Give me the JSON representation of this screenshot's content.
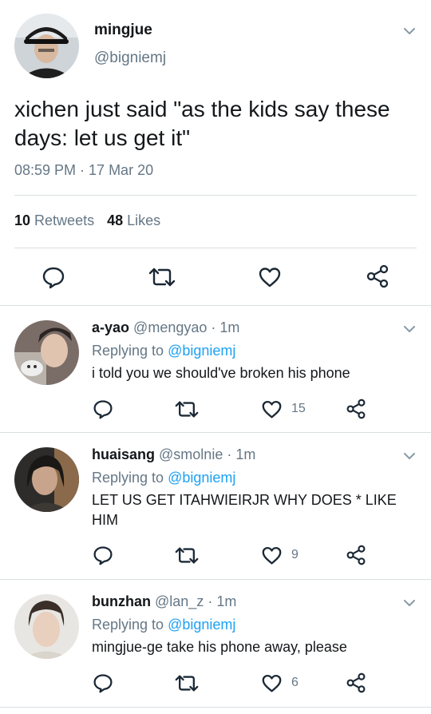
{
  "main_tweet": {
    "name": "mingjue",
    "handle": "@bigniemj",
    "text": "xichen just said \"as the kids say these days: let us get it\"",
    "timestamp": "08:59 PM · 17 Mar 20",
    "retweets_count": "10",
    "retweets_label": "Retweets",
    "likes_count": "48",
    "likes_label": "Likes",
    "actions": [
      "reply-icon",
      "retweet-icon",
      "like-icon",
      "share-icon"
    ]
  },
  "replies": [
    {
      "name": "a-yao",
      "handle": "@mengyao · 1m",
      "replying_prefix": "Replying to",
      "replying_to": "@bigniemj",
      "text": "i told you we should've broken his phone",
      "like_count": "15"
    },
    {
      "name": "huaisang",
      "handle": "@smolnie · 1m",
      "replying_prefix": "Replying to",
      "replying_to": "@bigniemj",
      "text": "LET US GET ITAHWIEIRJR WHY DOES * LIKE HIM",
      "like_count": "9"
    },
    {
      "name": "bunzhan",
      "handle": "@lan_z · 1m",
      "replying_prefix": "Replying to",
      "replying_to": "@bigniemj",
      "text": "mingjue-ge take his phone away, please",
      "like_count": "6"
    }
  ],
  "colors": {
    "text": "#14171a",
    "secondary": "#657786",
    "link": "#1da1f2",
    "divider": "#d9dfe3",
    "icon": "#1b2835"
  }
}
